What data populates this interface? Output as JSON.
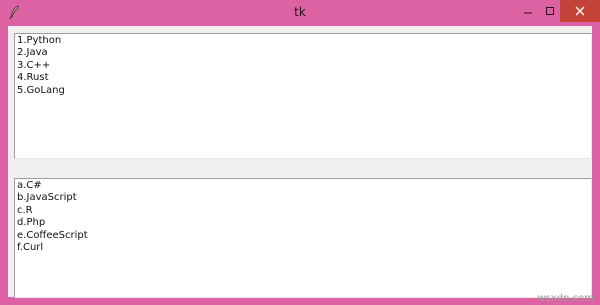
{
  "window": {
    "title": "tk",
    "titlebar_color": "#dc62a3",
    "close_button_color": "#c6433a",
    "icons": {
      "app": "feather-icon",
      "minimize": "minimize-icon",
      "maximize": "maximize-icon",
      "close": "close-icon"
    }
  },
  "listbox_languages": {
    "items": [
      "1.Python",
      "2.Java",
      "3.C++",
      "4.Rust",
      "5.GoLang"
    ]
  },
  "listbox_others": {
    "items": [
      "a.C#",
      "b.JavaScript",
      "c.R",
      "d.Php",
      "e.CoffeeScript",
      "f.Curl"
    ]
  },
  "watermark": {
    "text": "wsxdn.com"
  }
}
